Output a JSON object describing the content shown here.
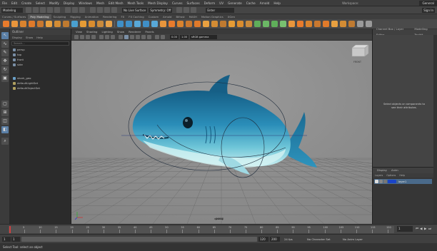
{
  "menubar": {
    "items": [
      "File",
      "Edit",
      "Create",
      "Select",
      "Modify",
      "Display",
      "Windows",
      "Mesh",
      "Edit Mesh",
      "Mesh Tools",
      "Mesh Display",
      "Curves",
      "Surfaces",
      "Deform",
      "UV",
      "Generate",
      "Cache",
      "Arnold",
      "Help"
    ],
    "workspace_label": "Workspace:",
    "workspace_value": "General"
  },
  "statusline": {
    "mode": "Modeling",
    "live_surface": "No Live Surface",
    "symmetry": "Symmetry: Off",
    "search_placeholder": "Enter",
    "sign_in": "Sign In"
  },
  "shelf": {
    "tabs": [
      "Curves / Surfaces",
      "Poly Modeling",
      "Sculpting",
      "Rigging",
      "Animation",
      "Rendering",
      "FX",
      "FX Caching",
      "Custom",
      "Arnold",
      "Bifrost",
      "MASH",
      "Motion Graphics",
      "XGen"
    ],
    "active_tab": "Poly Modeling"
  },
  "outliner": {
    "title": "Outliner",
    "menu": [
      "Display",
      "Show",
      "Help"
    ],
    "search_placeholder": "Search...",
    "items": [
      {
        "label": "persp",
        "icon_color": "#7a8fa6"
      },
      {
        "label": "top",
        "icon_color": "#7a8fa6"
      },
      {
        "label": "front",
        "icon_color": "#7a8fa6"
      },
      {
        "label": "side",
        "icon_color": "#7a8fa6"
      },
      {
        "label": "shark_geo",
        "icon_color": "#6aa0c8"
      },
      {
        "label": "defaultLightSet",
        "icon_color": "#b0a060"
      },
      {
        "label": "defaultObjectSet",
        "icon_color": "#b0a060"
      }
    ]
  },
  "viewport": {
    "menu": [
      "View",
      "Shading",
      "Lighting",
      "Show",
      "Renderer",
      "Panels"
    ],
    "field_exposure": "0.00",
    "field_gamma": "1.00",
    "colorspace": "sRGB gamma",
    "camera_label": "persp",
    "view_cube_label": "FRONT"
  },
  "channelbox": {
    "tabs": [
      "Channel Box / Layer Editor",
      "Modelling Toolkit"
    ],
    "message": "Select objects or components to see their attributes."
  },
  "layers": {
    "tabs": [
      "Display",
      "Anim"
    ],
    "menu": [
      "Layers",
      "Options",
      "Help"
    ],
    "row_name": "layer1",
    "row_color": "#1a44c8"
  },
  "timeslider": {
    "ticks": [
      "5",
      "10",
      "15",
      "20",
      "25",
      "30",
      "35",
      "40",
      "45",
      "50",
      "55",
      "60",
      "65",
      "70",
      "75",
      "80",
      "85",
      "90",
      "95",
      "100",
      "105",
      "110",
      "115",
      "120"
    ],
    "current_frame": "1"
  },
  "rangeslider": {
    "start": "1",
    "start_inner": "1",
    "end_inner": "120",
    "end": "200",
    "fps": "24 fps",
    "char_set": "No Character Set",
    "anim_layer": "No Anim Layer"
  },
  "helpline": {
    "text": "Select Tool: select an object",
    "mel": "MEL"
  },
  "colors": {
    "shark_top": "#1f6f97",
    "shark_mid": "#2a8fb8",
    "shark_belly": "#a8e3ea",
    "grid": "#6c6c6c",
    "viewport_bg": "#8f8f8f"
  }
}
